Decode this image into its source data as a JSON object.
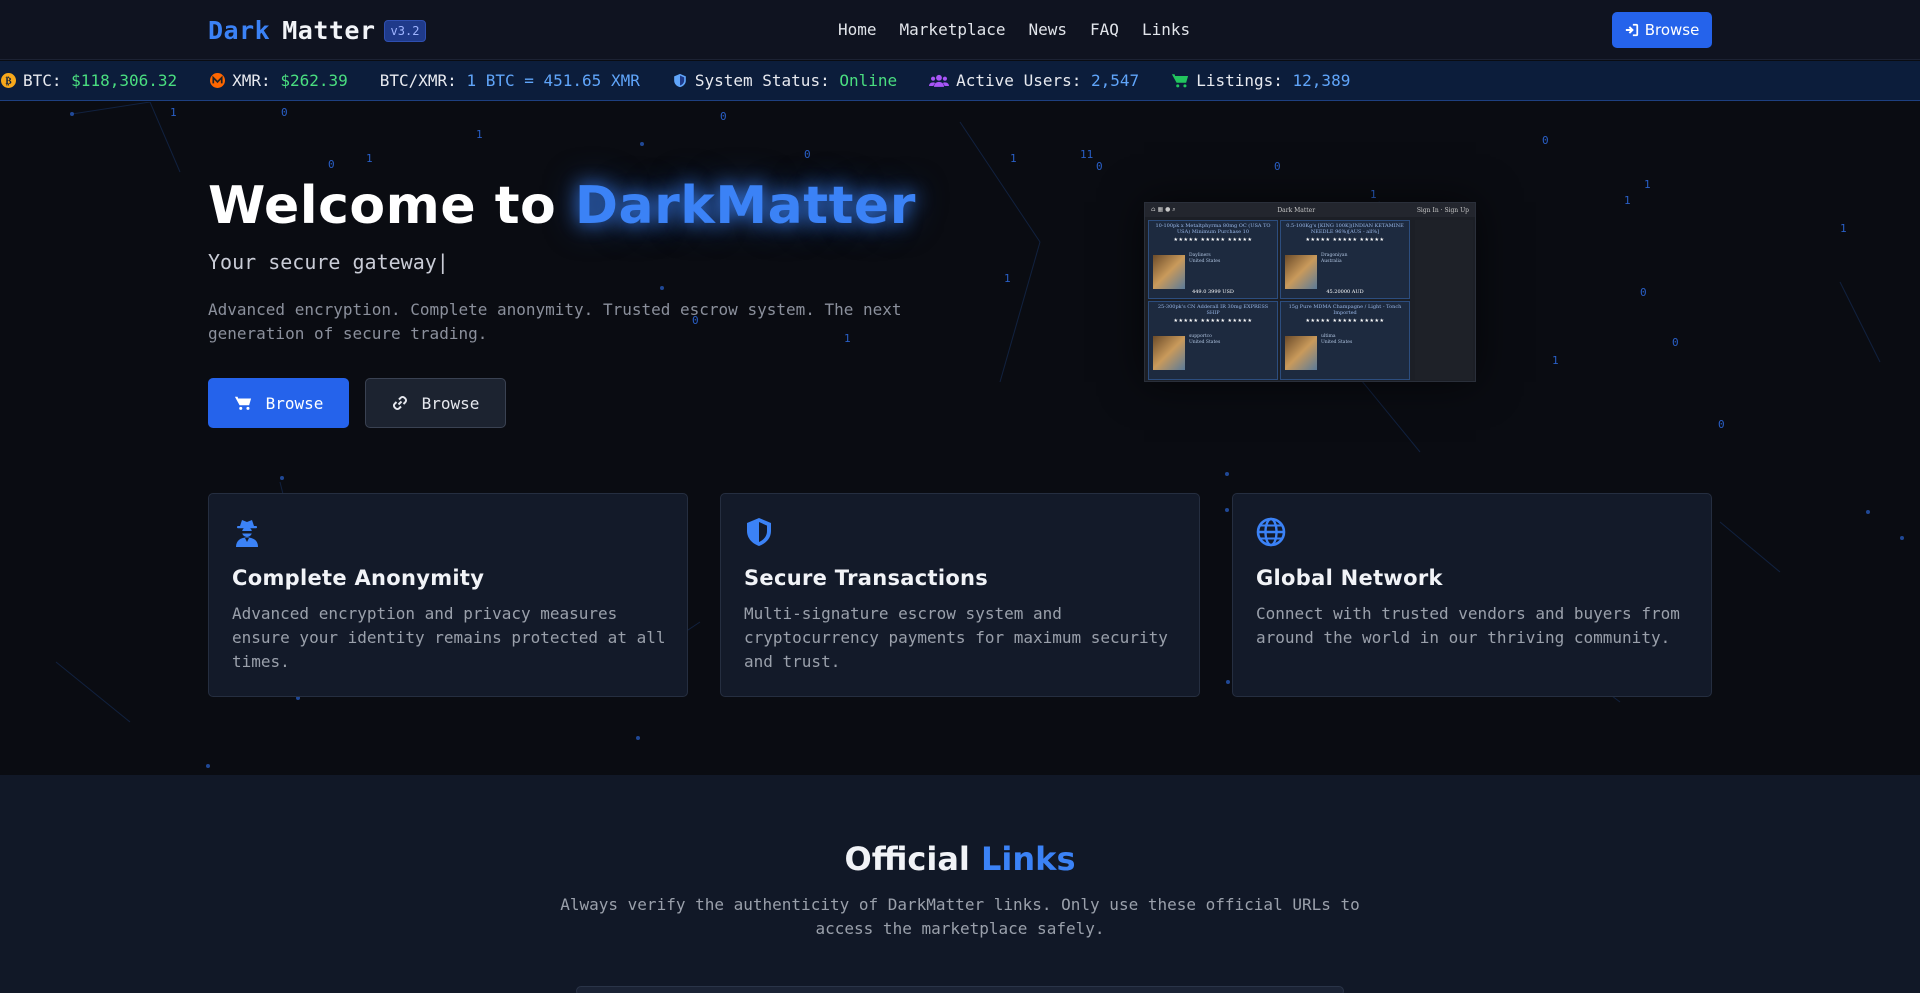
{
  "header": {
    "brand_dark": "Dark",
    "brand_matter": "Matter",
    "version": "v3.2",
    "nav": [
      "Home",
      "Marketplace",
      "News",
      "FAQ",
      "Links"
    ],
    "button_label": "Browse"
  },
  "ticker": {
    "btc_label": "BTC:",
    "btc_value": "$118,306.32",
    "xmr_label": "XMR:",
    "xmr_value": "$262.39",
    "pair_label": "BTC/XMR:",
    "pair_value": "1 BTC = 451.65 XMR",
    "status_label": "System Status:",
    "status_value": "Online",
    "users_label": "Active Users:",
    "users_value": "2,547",
    "listings_label": "Listings:",
    "listings_value": "12,389"
  },
  "hero": {
    "title_prefix": "Welcome to",
    "title_accent": "DarkMatter",
    "subtitle": "Your secure gateway|",
    "description": "Advanced encryption. Complete anonymity. Trusted escrow system. The next generation of secure trading.",
    "primary_button": "Browse",
    "secondary_button": "Browse"
  },
  "preview": {
    "title": "Dark Matter",
    "sign_in": "Sign In",
    "sign_up": "Sign Up",
    "cards": [
      {
        "title": "10-100pk x Metaltphyrma 80mg OC (USA TO USA) Minimum Purchase 10",
        "vendor": "Dayliners",
        "from": "United States",
        "price": "449.0 3999 USD"
      },
      {
        "title": "0.5-100Kg's [KING 100K](INDIAN KETAMINE NEEDLE 96%)[AUS - all%]",
        "vendor": "Dragoniyan",
        "from": "Australia",
        "price": "45.20000 AUD"
      },
      {
        "title": "25-300pk's CN Adderall IR 30mg EXPRESS SHIP",
        "vendor": "supportco",
        "from": "United States",
        "price": ""
      },
      {
        "title": "15g Pure MDMA Champagne / Light - Tonch Imported",
        "vendor": "ultima",
        "from": "United States",
        "price": ""
      }
    ]
  },
  "features": [
    {
      "icon": "user-secret-icon",
      "title": "Complete Anonymity",
      "description": "Advanced encryption and privacy measures ensure your identity remains protected at all times."
    },
    {
      "icon": "shield-icon",
      "title": "Secure Transactions",
      "description": "Multi-signature escrow system and cryptocurrency payments for maximum security and trust."
    },
    {
      "icon": "globe-icon",
      "title": "Global Network",
      "description": "Connect with trusted vendors and buyers from around the world in our thriving community."
    }
  ],
  "links": {
    "title_prefix": "Official",
    "title_accent": "Links",
    "description": "Always verify the authenticity of DarkMatter links. Only use these official URLs to access the marketplace safely."
  },
  "colors": {
    "accent": "#3b82f6",
    "button": "#2563eb",
    "positive": "#4ade80",
    "background": "#0a0c12"
  }
}
